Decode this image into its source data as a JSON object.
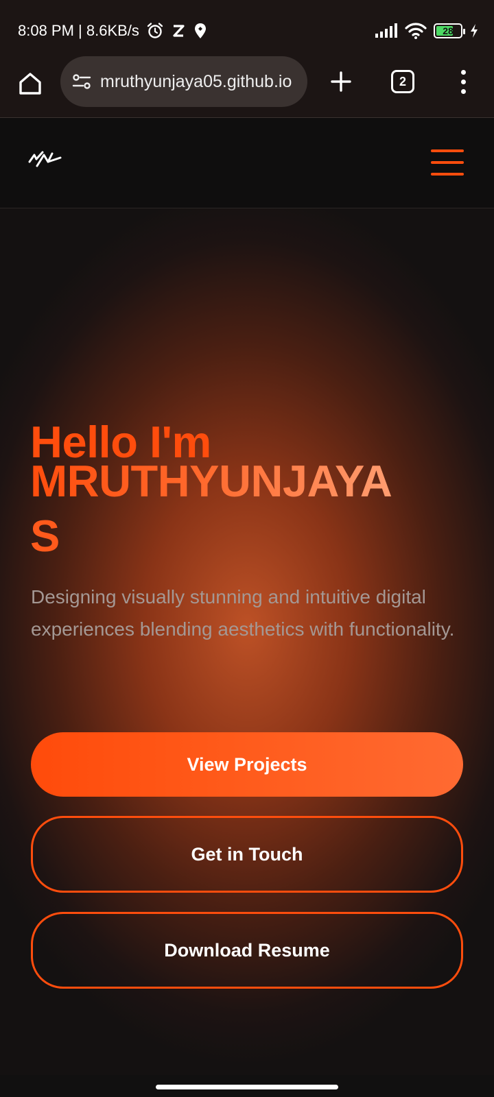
{
  "status_bar": {
    "time_speed": "8:08 PM | 8.6KB/s",
    "battery": "28"
  },
  "browser": {
    "url": "mruthyunjaya05.github.io",
    "tab_count": "2"
  },
  "hero": {
    "greeting": "Hello I'm",
    "name_line1": "MRUTHYUNJAYA",
    "name_line2": "S",
    "description": "Designing visually stunning and intuitive digital experiences blending aesthetics with functionality."
  },
  "buttons": {
    "view_projects": "View Projects",
    "get_in_touch": "Get in Touch",
    "download_resume": "Download Resume"
  },
  "colors": {
    "accent": "#ff4d0d",
    "background": "#111010"
  }
}
